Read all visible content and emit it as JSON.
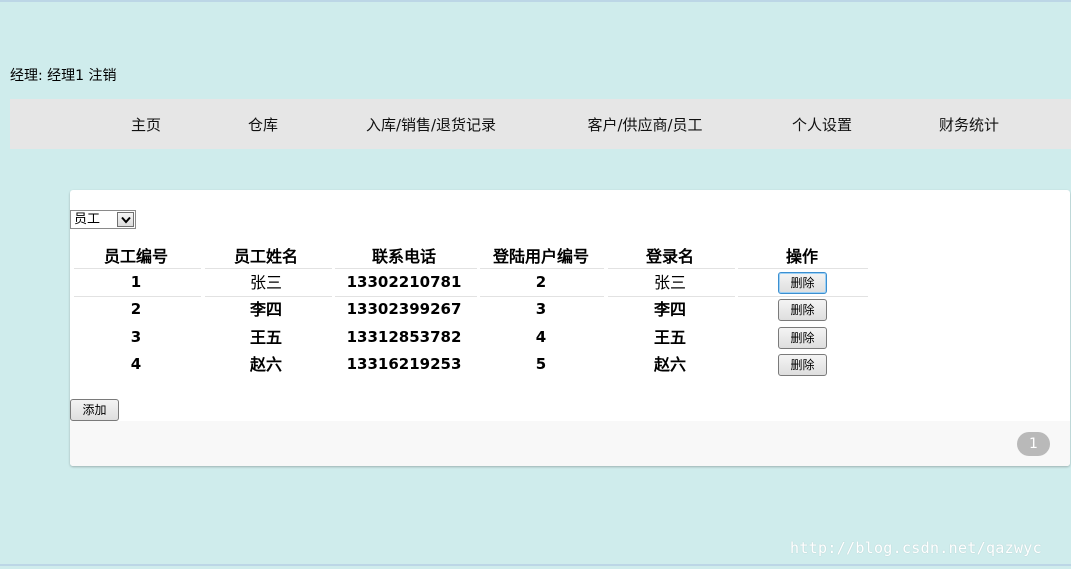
{
  "user_bar": {
    "role_label": "经理:",
    "user_name": "经理1",
    "logout_label": "注销"
  },
  "nav": {
    "items": [
      {
        "label": "主页"
      },
      {
        "label": "仓库"
      },
      {
        "label": "入库/销售/退货记录"
      },
      {
        "label": "客户/供应商/员工"
      },
      {
        "label": "个人设置"
      },
      {
        "label": "财务统计"
      }
    ]
  },
  "filter": {
    "selected": "员工"
  },
  "table": {
    "headers": [
      "员工编号",
      "员工姓名",
      "联系电话",
      "登陆用户编号",
      "登录名",
      "操作"
    ],
    "rows": [
      {
        "id": "1",
        "name": "张三",
        "phone": "13302210781",
        "user_id": "2",
        "login": "张三",
        "action": "删除"
      },
      {
        "id": "2",
        "name": "李四",
        "phone": "13302399267",
        "user_id": "3",
        "login": "李四",
        "action": "删除"
      },
      {
        "id": "3",
        "name": "王五",
        "phone": "13312853782",
        "user_id": "4",
        "login": "王五",
        "action": "删除"
      },
      {
        "id": "4",
        "name": "赵六",
        "phone": "13316219253",
        "user_id": "5",
        "login": "赵六",
        "action": "删除"
      }
    ]
  },
  "add_label": "添加",
  "pagination": {
    "current": "1"
  },
  "watermark": "http://blog.csdn.net/qazwyc",
  "colors": {
    "page_bg": "#cfecec",
    "nav_bg": "#e6e6e6",
    "panel_bg": "#ffffff",
    "pager_bg": "#b9b9b9"
  }
}
